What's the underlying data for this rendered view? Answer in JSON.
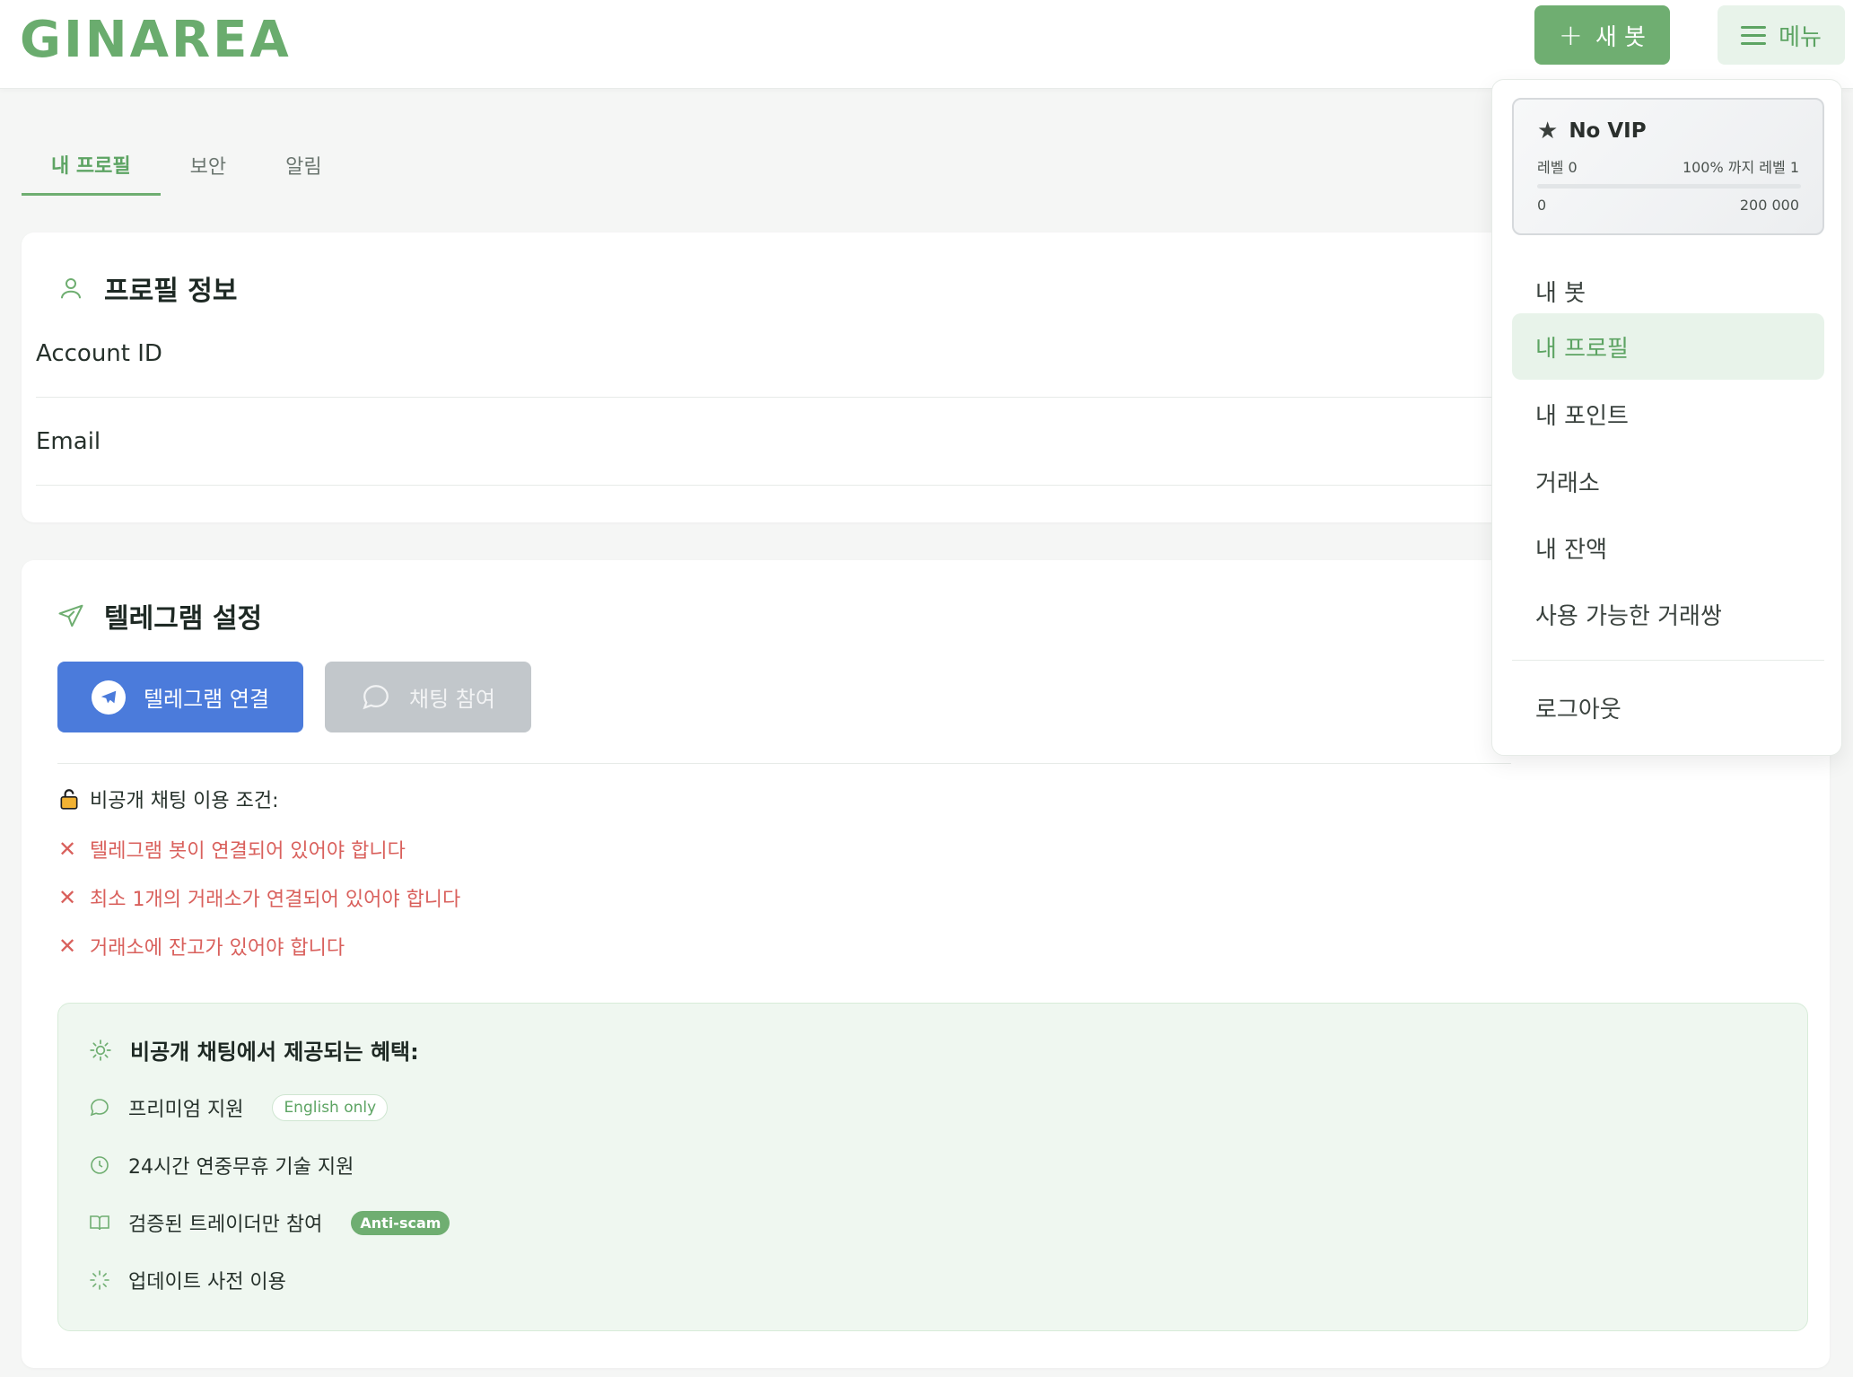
{
  "header": {
    "logo": "GINAREA",
    "new_bot_label": "새 봇",
    "menu_label": "메뉴"
  },
  "tabs": [
    {
      "label": "내 프로필",
      "active": true
    },
    {
      "label": "보안",
      "active": false
    },
    {
      "label": "알림",
      "active": false
    }
  ],
  "profile": {
    "title": "프로필 정보",
    "rows": [
      {
        "label": "Account ID"
      },
      {
        "label": "Email"
      }
    ]
  },
  "telegram": {
    "title": "텔레그램 설정",
    "connect_label": "텔레그램 연결",
    "chat_label": "채팅 참여",
    "conditions_title": "비공개 채팅 이용 조건:",
    "requirements": [
      "텔레그램 봇이 연결되어 있어야 합니다",
      "최소 1개의 거래소가 연결되어 있어야 합니다",
      "거래소에 잔고가 있어야 합니다"
    ],
    "benefits_title": "비공개 채팅에서 제공되는 혜택:",
    "benefits": [
      {
        "label": "프리미엄 지원",
        "badge": "English only"
      },
      {
        "label": "24시간 연중무휴 기술 지원"
      },
      {
        "label": "검증된 트레이더만 참여",
        "badge": "Anti-scam"
      },
      {
        "label": "업데이트 사전 이용"
      }
    ]
  },
  "dropdown": {
    "vip": {
      "title": "No VIP",
      "level": "레벨 0",
      "next": "100% 까지 레벨 1",
      "min": "0",
      "max": "200 000",
      "progress": 0
    },
    "items": [
      {
        "label": "내 봇",
        "active": false
      },
      {
        "label": "내 프로필",
        "active": true
      },
      {
        "label": "내 포인트",
        "active": false
      },
      {
        "label": "거래소",
        "active": false
      },
      {
        "label": "내 잔액",
        "active": false
      },
      {
        "label": "사용 가능한 거래쌍",
        "active": false
      }
    ],
    "logout": "로그아웃"
  },
  "colors": {
    "brand_green": "#6fae71",
    "telegram_blue": "#4b7bdb",
    "error_red": "#d9605c"
  }
}
